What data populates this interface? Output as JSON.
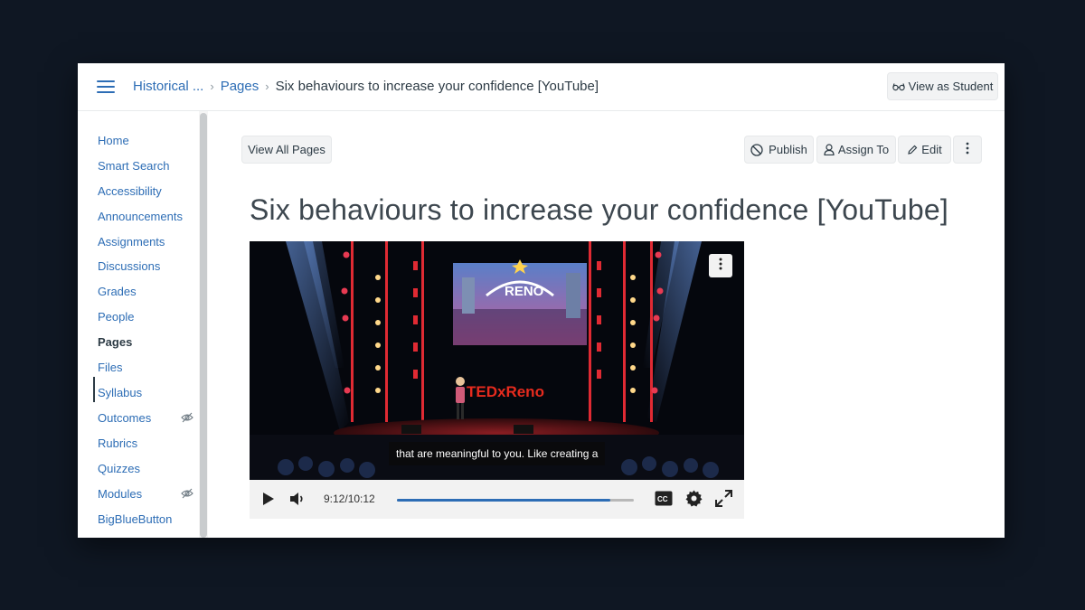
{
  "header": {
    "breadcrumbs": [
      {
        "label": "Historical ..."
      },
      {
        "label": "Pages"
      },
      {
        "label": "Six behaviours to increase your confidence [YouTube]"
      }
    ],
    "view_as_student_label": "View as Student",
    "view_as_student_icon": "glasses-icon"
  },
  "sidebar": {
    "items": [
      {
        "label": "Home"
      },
      {
        "label": "Smart Search"
      },
      {
        "label": "Accessibility"
      },
      {
        "label": "Announcements"
      },
      {
        "label": "Assignments"
      },
      {
        "label": "Discussions"
      },
      {
        "label": "Grades"
      },
      {
        "label": "People"
      },
      {
        "label": "Pages",
        "active": true
      },
      {
        "label": "Files"
      },
      {
        "label": "Syllabus"
      },
      {
        "label": "Outcomes",
        "hidden_from_students": true
      },
      {
        "label": "Rubrics"
      },
      {
        "label": "Quizzes"
      },
      {
        "label": "Modules",
        "hidden_from_students": true
      },
      {
        "label": "BigBlueButton"
      }
    ]
  },
  "toolbar": {
    "view_all_pages_label": "View All Pages",
    "publish_label": "Publish",
    "assign_to_label": "Assign To",
    "edit_label": "Edit"
  },
  "page": {
    "title": "Six behaviours to increase your confidence [YouTube]"
  },
  "video": {
    "caption": "that are meaningful to you. Like creating a",
    "time": "9:12/10:12",
    "progress": 0.902,
    "stage_brand": "TEDxReno",
    "screen_text": "RENO"
  },
  "colors": {
    "link": "#2d6db5",
    "text": "#2d3b45",
    "background": "#0f1723"
  }
}
